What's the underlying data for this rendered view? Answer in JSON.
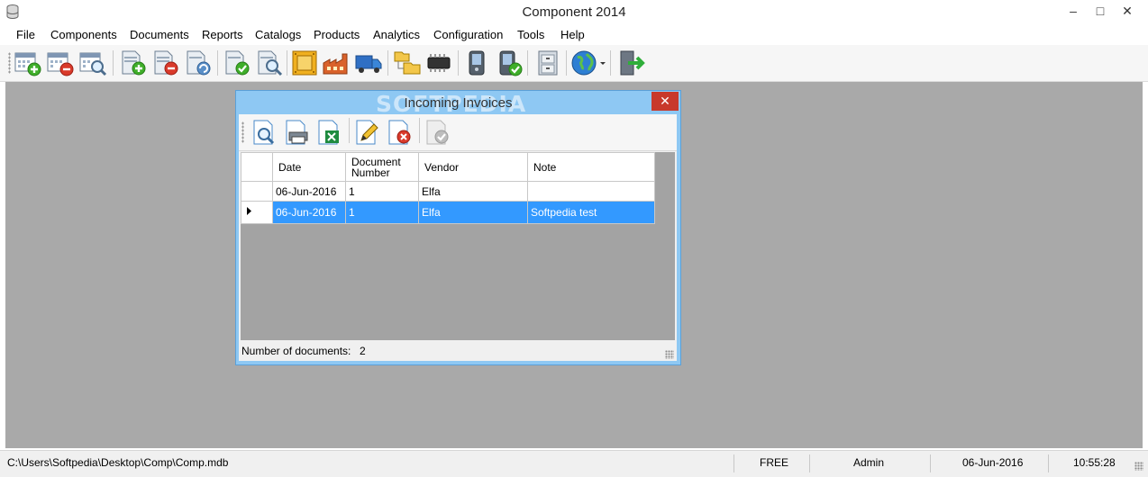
{
  "app": {
    "title": "Component 2014",
    "window_controls": {
      "minimize": "–",
      "maximize": "□",
      "close": "✕"
    }
  },
  "menu": [
    "File",
    "Components",
    "Documents",
    "Reports",
    "Catalogs",
    "Products",
    "Analytics",
    "Configuration",
    "Tools",
    "Help"
  ],
  "toolbar_icons": [
    "calendar-add-icon",
    "calendar-remove-icon",
    "calendar-search-icon",
    "document-add-icon",
    "document-remove-icon",
    "document-refresh-icon",
    "document-approve-icon",
    "document-search-icon",
    "component-board-icon",
    "factory-icon",
    "truck-icon",
    "folder-tree-icon",
    "chip-icon",
    "handheld-device-icon",
    "handheld-check-icon",
    "cabinet-icon",
    "globe-icon",
    "exit-door-icon"
  ],
  "dialog": {
    "title": "Incoming Invoices",
    "watermark": "SOFTPEDIA",
    "close": "✕",
    "toolbar_icons": [
      "preview-icon",
      "print-icon",
      "excel-export-icon",
      "edit-icon",
      "delete-icon",
      "approve-icon"
    ],
    "columns": [
      "Date",
      "Document Number",
      "Vendor",
      "Note"
    ],
    "rows": [
      {
        "date": "06-Jun-2016",
        "number": "1",
        "vendor": "Elfa",
        "note": ""
      },
      {
        "date": "06-Jun-2016",
        "number": "1",
        "vendor": "Elfa",
        "note": "Softpedia test"
      }
    ],
    "selected_row": 1,
    "status_label": "Number of documents:",
    "status_count": "2"
  },
  "statusbar": {
    "path": "C:\\Users\\Softpedia\\Desktop\\Comp\\Comp.mdb",
    "license": "FREE",
    "user": "Admin",
    "date": "06-Jun-2016",
    "time": "10:55:28"
  },
  "colors": {
    "workspace": "#a9a9a9",
    "dialog_frame": "#8ec8f3",
    "selection": "#3399ff",
    "close_red": "#c8392b"
  }
}
